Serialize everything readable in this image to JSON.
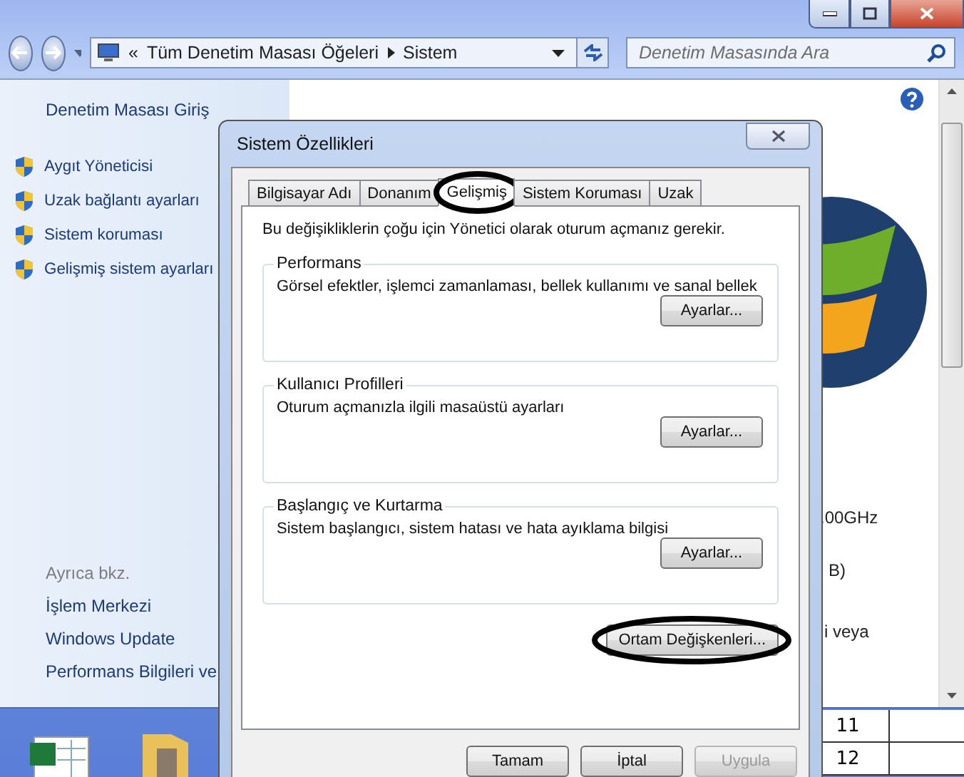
{
  "explorer": {
    "address": {
      "parent_chevron": "«",
      "crumbs": [
        "Tüm Denetim Masası Öğeleri",
        "Sistem"
      ]
    },
    "search": {
      "placeholder": "Denetim Masasında Ara"
    },
    "sidebar": {
      "home": "Denetim Masası Giriş",
      "tasks": [
        "Aygıt Yöneticisi",
        "Uzak bağlantı ayarları",
        "Sistem koruması",
        "Gelişmiş sistem ayarları"
      ],
      "see_also_title": "Ayrıca bkz.",
      "see_also": [
        "İşlem Merkezi",
        "Windows Update",
        "Performans Bilgileri ve"
      ]
    },
    "content_fragments": [
      ".00GHz",
      "B)",
      "i veya"
    ]
  },
  "spreadsheet": {
    "row_numbers": [
      "11",
      "12"
    ]
  },
  "dialog": {
    "title": "Sistem Özellikleri",
    "tabs": [
      {
        "label": "Bilgisayar Adı",
        "selected": false,
        "circled": false
      },
      {
        "label": "Donanım",
        "selected": false,
        "circled": false
      },
      {
        "label": "Gelişmiş",
        "selected": true,
        "circled": true
      },
      {
        "label": "Sistem Koruması",
        "selected": false,
        "circled": false
      },
      {
        "label": "Uzak",
        "selected": false,
        "circled": false
      }
    ],
    "notice": "Bu değişikliklerin çoğu için Yönetici olarak oturum açmanız gerekir.",
    "groups": [
      {
        "title": "Performans",
        "description": "Görsel efektler, işlemci zamanlaması, bellek kullanımı ve sanal bellek",
        "button": "Ayarlar..."
      },
      {
        "title": "Kullanıcı Profilleri",
        "description": "Oturum açmanızla ilgili masaüstü ayarları",
        "button": "Ayarlar..."
      },
      {
        "title": "Başlangıç ve Kurtarma",
        "description": "Sistem başlangıcı, sistem hatası ve hata ayıklama bilgisi",
        "button": "Ayarlar..."
      }
    ],
    "env_button": {
      "label": "Ortam Değişkenleri...",
      "circled": true
    },
    "buttons": [
      {
        "label": "Tamam",
        "disabled": false
      },
      {
        "label": "İptal",
        "disabled": false
      },
      {
        "label": "Uygula",
        "disabled": true
      }
    ]
  }
}
